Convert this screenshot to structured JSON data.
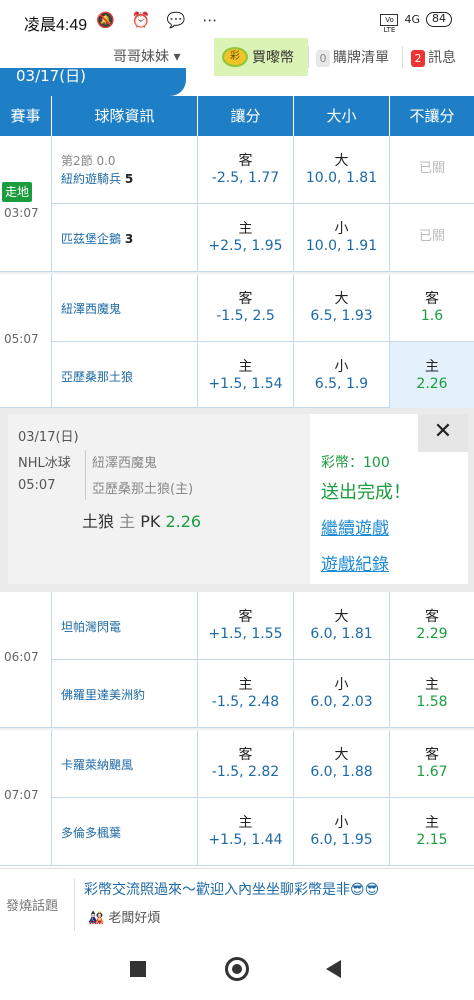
{
  "status_bar": {
    "time": "凌晨4:49",
    "icons": "🔕 ⏰ 💬 ⋯",
    "volte": "Vo LTE",
    "net": "4G",
    "battery": "84"
  },
  "appbar": {
    "user": "哥哥妹妹 ▾",
    "coin_icon": "彩",
    "coins_label": "買嚟幣",
    "cart_count": "0",
    "cart_label": "購牌清單",
    "msg_count": "2",
    "msg_label": "訊息"
  },
  "date_tab": "03/17(日)",
  "header": {
    "c1": "賽事",
    "c2": "球隊資訊",
    "c3": "讓分",
    "c4": "大小",
    "c5": "不讓分"
  },
  "games": [
    {
      "time": "03:07",
      "live": "走地",
      "rows": [
        {
          "pre": "第2節 0.0",
          "team": "紐約遊騎兵",
          "score": "5",
          "hcap_side": "客",
          "hcap_line": "-2.5,",
          "hcap_odds": "1.77",
          "ou_side": "大",
          "ou_line": "10.0,",
          "ou_odds": "1.81",
          "ml": "已關"
        },
        {
          "pre": "",
          "team": "匹茲堡企鵝",
          "score": "3",
          "hcap_side": "主",
          "hcap_line": "+2.5,",
          "hcap_odds": "1.95",
          "ou_side": "小",
          "ou_line": "10.0,",
          "ou_odds": "1.91",
          "ml": "已關"
        }
      ]
    },
    {
      "time": "05:07",
      "live": "",
      "rows": [
        {
          "pre": "",
          "team": "紐澤西魔鬼",
          "score": "",
          "hcap_side": "客",
          "hcap_line": "-1.5,",
          "hcap_odds": "2.5",
          "ou_side": "大",
          "ou_line": "6.5,",
          "ou_odds": "1.93",
          "ml_side": "客",
          "ml_odds": "1.6"
        },
        {
          "pre": "",
          "team": "亞歷桑那土狼",
          "score": "",
          "hcap_side": "主",
          "hcap_line": "+1.5,",
          "hcap_odds": "1.54",
          "ou_side": "小",
          "ou_line": "6.5,",
          "ou_odds": "1.9",
          "ml_side": "主",
          "ml_odds": "2.26"
        }
      ]
    },
    {
      "time": "06:07",
      "live": "",
      "rows": [
        {
          "pre": "",
          "team": "坦帕灣閃電",
          "score": "",
          "hcap_side": "客",
          "hcap_line": "+1.5,",
          "hcap_odds": "1.55",
          "ou_side": "大",
          "ou_line": "6.0,",
          "ou_odds": "1.81",
          "ml_side": "客",
          "ml_odds": "2.29"
        },
        {
          "pre": "",
          "team": "佛羅里達美洲豹",
          "score": "",
          "hcap_side": "主",
          "hcap_line": "-1.5,",
          "hcap_odds": "2.48",
          "ou_side": "小",
          "ou_line": "6.0,",
          "ou_odds": "2.03",
          "ml_side": "主",
          "ml_odds": "1.58"
        }
      ]
    },
    {
      "time": "07:07",
      "live": "",
      "rows": [
        {
          "pre": "",
          "team": "卡羅萊納颶風",
          "score": "",
          "hcap_side": "客",
          "hcap_line": "-1.5,",
          "hcap_odds": "2.82",
          "ou_side": "大",
          "ou_line": "6.0,",
          "ou_odds": "1.88",
          "ml_side": "客",
          "ml_odds": "1.67"
        },
        {
          "pre": "",
          "team": "多倫多楓葉",
          "score": "",
          "hcap_side": "主",
          "hcap_line": "+1.5,",
          "hcap_odds": "1.44",
          "ou_side": "小",
          "ou_line": "6.0,",
          "ou_odds": "1.95",
          "ml_side": "主",
          "ml_odds": "2.15"
        }
      ]
    }
  ],
  "confirm": {
    "date": "03/17(日)",
    "league": "NHL冰球",
    "time": "05:07",
    "home": "紐澤西魔鬼",
    "away": "亞歷桑那土狼(主)",
    "pick_team": "土狼",
    "pick_side": "主",
    "pick_type": "PK",
    "pick_odds": "2.26",
    "stake": "彩幣：100",
    "done": "送出完成！",
    "continue": "繼續遊戲",
    "history": "遊戲紀錄",
    "close": "✕"
  },
  "chat": {
    "label": "發燒話題",
    "text": "彩幣交流照過來～歡迎入內坐坐聊彩幣是非😎😎",
    "author": "🎎 老闆好煩"
  }
}
